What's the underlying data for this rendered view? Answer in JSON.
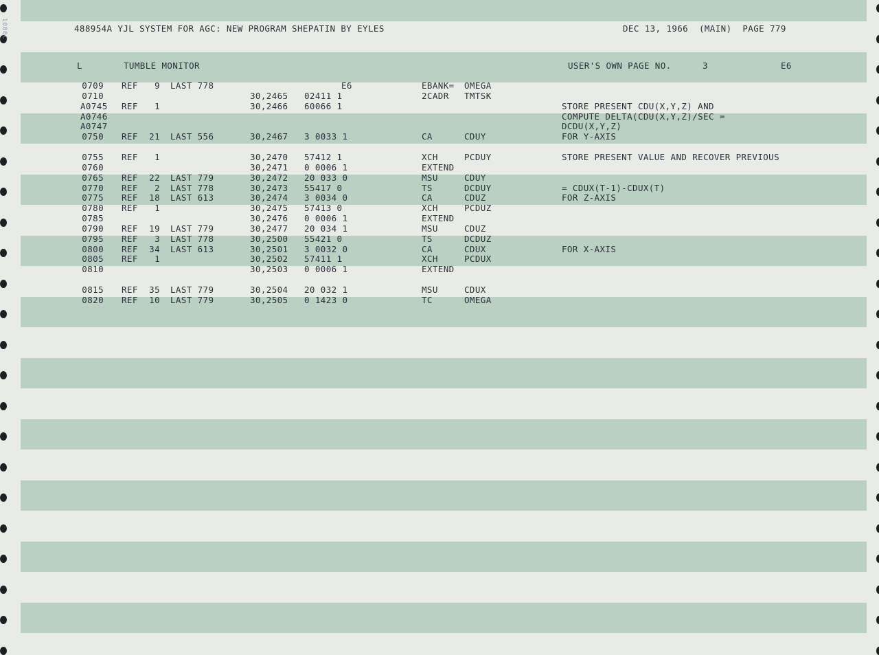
{
  "header": {
    "left": "488954A YJL SYSTEM FOR AGC: NEW PROGRAM SHEPATIN BY EYLES",
    "right": "DEC 13, 1966  (MAIN)  PAGE 779"
  },
  "section": {
    "marker": "L",
    "title": "TUMBLE MONITOR",
    "users_page_label": "USER'S OWN PAGE NO.",
    "users_page_no": "3",
    "bank": "E6"
  },
  "margin_note": "1080C",
  "rows": [
    {
      "line": "0709",
      "ref": "REF",
      "refnum": "9",
      "last": "LAST 778",
      "addr": "",
      "code": "E6",
      "op": "EBANK=",
      "operand": "OMEGA",
      "comment": ""
    },
    {
      "line": "0710",
      "ref": "",
      "refnum": "",
      "last": "",
      "addr": "30,2465",
      "code": "02411 1",
      "op": "2CADR",
      "operand": "TMTSK",
      "comment": ""
    },
    {
      "line": "A0745",
      "ref": "REF",
      "refnum": "1",
      "last": "",
      "addr": "30,2466",
      "code": "60066 1",
      "op": "",
      "operand": "",
      "comment": "STORE PRESENT CDU(X,Y,Z) AND"
    },
    {
      "line": "A0746",
      "ref": "",
      "refnum": "",
      "last": "",
      "addr": "",
      "code": "",
      "op": "",
      "operand": "",
      "comment": "COMPUTE DELTA(CDU(X,Y,Z)/SEC ="
    },
    {
      "line": "A0747",
      "ref": "",
      "refnum": "",
      "last": "",
      "addr": "",
      "code": "",
      "op": "",
      "operand": "",
      "comment": "DCDU(X,Y,Z)"
    },
    {
      "line": "0750",
      "ref": "REF",
      "refnum": "21",
      "last": "LAST 556",
      "addr": "30,2467",
      "code": "3 0033 1",
      "op": "CA",
      "operand": "CDUY",
      "comment": "FOR Y-AXIS"
    },
    {
      "line": "",
      "ref": "",
      "refnum": "",
      "last": "",
      "addr": "",
      "code": "",
      "op": "",
      "operand": "",
      "comment": ""
    },
    {
      "line": "0755",
      "ref": "REF",
      "refnum": "1",
      "last": "",
      "addr": "30,2470",
      "code": "57412 1",
      "op": "XCH",
      "operand": "PCDUY",
      "comment": "STORE PRESENT VALUE AND RECOVER PREVIOUS"
    },
    {
      "line": "0760",
      "ref": "",
      "refnum": "",
      "last": "",
      "addr": "30,2471",
      "code": "0 0006 1",
      "op": "EXTEND",
      "operand": "",
      "comment": ""
    },
    {
      "line": "0765",
      "ref": "REF",
      "refnum": "22",
      "last": "LAST 779",
      "addr": "30,2472",
      "code": "20 033 0",
      "op": "MSU",
      "operand": "CDUY",
      "comment": ""
    },
    {
      "line": "0770",
      "ref": "REF",
      "refnum": "2",
      "last": "LAST 778",
      "addr": "30,2473",
      "code": "55417 0",
      "op": "TS",
      "operand": "DCDUY",
      "comment": "= CDUX(T-1)-CDUX(T)"
    },
    {
      "line": "0775",
      "ref": "REF",
      "refnum": "18",
      "last": "LAST 613",
      "addr": "30,2474",
      "code": "3 0034 0",
      "op": "CA",
      "operand": "CDUZ",
      "comment": "FOR Z-AXIS"
    },
    {
      "line": "0780",
      "ref": "REF",
      "refnum": "1",
      "last": "",
      "addr": "30,2475",
      "code": "57413 0",
      "op": "XCH",
      "operand": "PCDUZ",
      "comment": ""
    },
    {
      "line": "0785",
      "ref": "",
      "refnum": "",
      "last": "",
      "addr": "30,2476",
      "code": "0 0006 1",
      "op": "EXTEND",
      "operand": "",
      "comment": ""
    },
    {
      "line": "0790",
      "ref": "REF",
      "refnum": "19",
      "last": "LAST 779",
      "addr": "30,2477",
      "code": "20 034 1",
      "op": "MSU",
      "operand": "CDUZ",
      "comment": ""
    },
    {
      "line": "0795",
      "ref": "REF",
      "refnum": "3",
      "last": "LAST 778",
      "addr": "30,2500",
      "code": "55421 0",
      "op": "TS",
      "operand": "DCDUZ",
      "comment": ""
    },
    {
      "line": "0800",
      "ref": "REF",
      "refnum": "34",
      "last": "LAST 613",
      "addr": "30,2501",
      "code": "3 0032 0",
      "op": "CA",
      "operand": "CDUX",
      "comment": "FOR X-AXIS"
    },
    {
      "line": "0805",
      "ref": "REF",
      "refnum": "1",
      "last": "",
      "addr": "30,2502",
      "code": "57411 1",
      "op": "XCH",
      "operand": "PCDUX",
      "comment": ""
    },
    {
      "line": "0810",
      "ref": "",
      "refnum": "",
      "last": "",
      "addr": "30,2503",
      "code": "0 0006 1",
      "op": "EXTEND",
      "operand": "",
      "comment": ""
    },
    {
      "line": "",
      "ref": "",
      "refnum": "",
      "last": "",
      "addr": "",
      "code": "",
      "op": "",
      "operand": "",
      "comment": ""
    },
    {
      "line": "0815",
      "ref": "REF",
      "refnum": "35",
      "last": "LAST 779",
      "addr": "30,2504",
      "code": "20 032 1",
      "op": "MSU",
      "operand": "CDUX",
      "comment": ""
    },
    {
      "line": "0820",
      "ref": "REF",
      "refnum": "10",
      "last": "LAST 779",
      "addr": "30,2505",
      "code": "0 1423 0",
      "op": "TC",
      "operand": "OMEGA",
      "comment": ""
    }
  ],
  "colors": {
    "band": "#b9d0c2",
    "paper": "#e9ece6",
    "ink": "#2a2f3a"
  }
}
